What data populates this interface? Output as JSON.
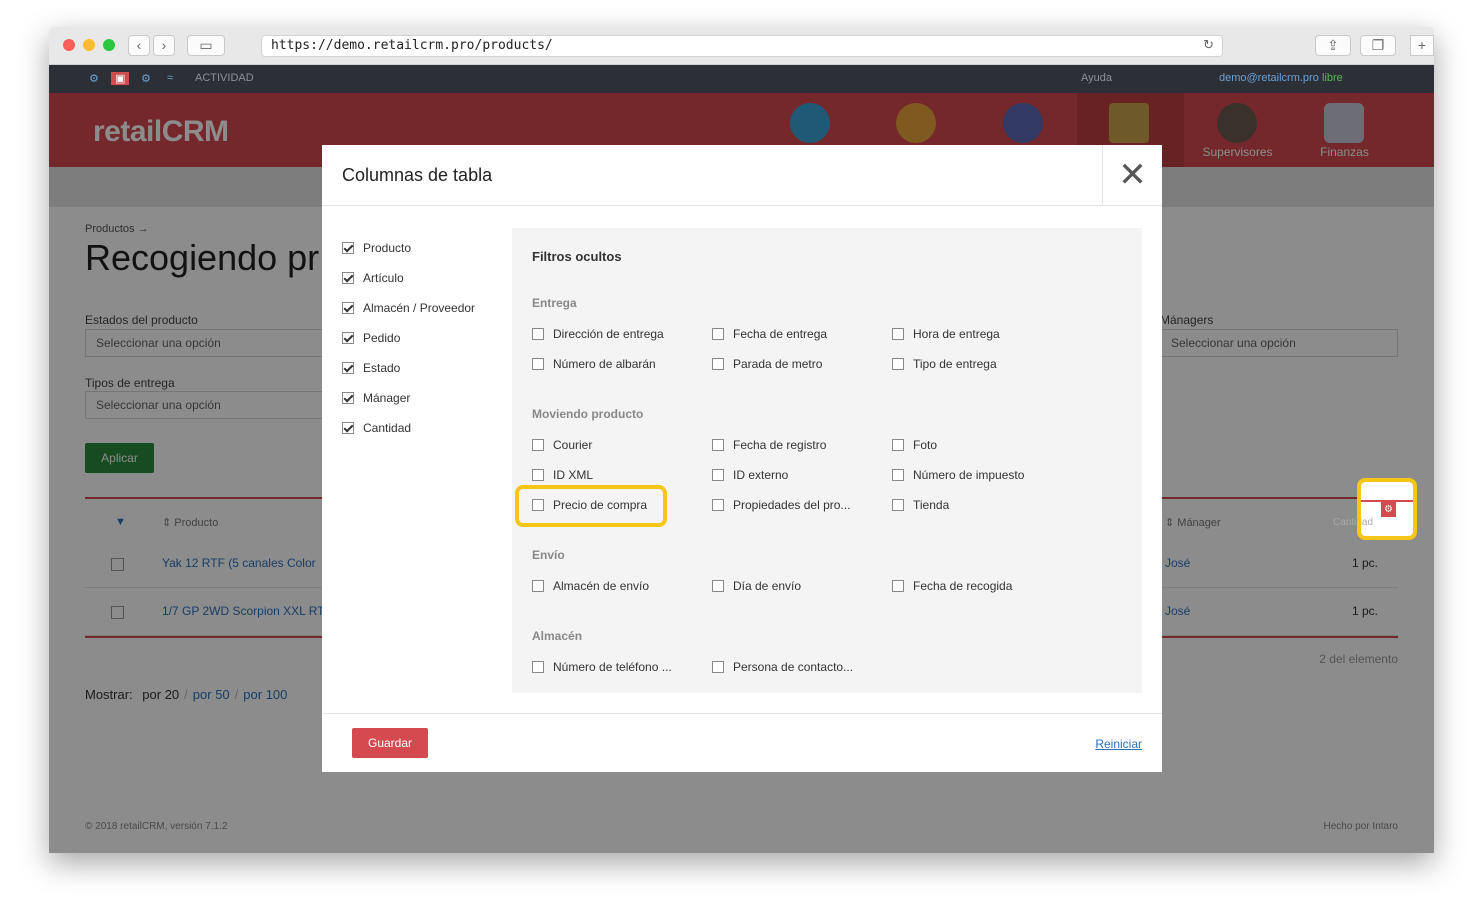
{
  "browser": {
    "url": "https://demo.retailcrm.pro/products/",
    "reload_glyph": "↻",
    "back_glyph": "‹",
    "forward_glyph": "›",
    "sidebar_glyph": "▭",
    "share_glyph": "⇪",
    "tabs_glyph": "❐",
    "newtab_glyph": "+"
  },
  "topbar": {
    "activity": "ACTIVIDAD",
    "help": "Ayuda",
    "user": "demo@retailcrm.pro",
    "status": "libre"
  },
  "header": {
    "logo": "retailCRM",
    "nav": [
      {
        "label": "",
        "icon": "cart-icon"
      },
      {
        "label": "",
        "icon": "customer-icon"
      },
      {
        "label": "",
        "icon": "chat-icon"
      },
      {
        "label": "",
        "icon": "box-icon"
      },
      {
        "label": "Supervisores",
        "icon": "supervisor-icon"
      },
      {
        "label": "Finanzas",
        "icon": "finance-icon"
      }
    ]
  },
  "page": {
    "breadcrumb": "Productos →",
    "title": "Recogiendo pr",
    "filters": {
      "product_states_label": "Estados del producto",
      "product_states_placeholder": "Seleccionar una opción",
      "delivery_types_label": "Tipos de entrega",
      "delivery_types_placeholder": "Seleccionar una opción",
      "managers_label": "Mánagers",
      "managers_placeholder": "Seleccionar una opción"
    },
    "apply_label": "Aplicar",
    "table": {
      "headers": {
        "product": "Producto",
        "manager": "Mánager",
        "quantity": "Cantidad"
      },
      "rows": [
        {
          "product": "Yak 12 RTF (5 canales Color",
          "manager": "José",
          "quantity": "1 pc."
        },
        {
          "product": "1/7 GP 2WD Scorpion XXL RT",
          "manager": "José",
          "quantity": "1 pc."
        }
      ],
      "count": "2 del elemento"
    },
    "show": {
      "label": "Mostrar:",
      "options": [
        "por 20",
        "por 50",
        "por 100"
      ]
    },
    "footer_left": "© 2018 retailCRM, versión 7.1.2",
    "footer_right": "Hecho por Intaro"
  },
  "modal": {
    "title": "Columnas de tabla",
    "close_glyph": "✕",
    "visible_columns": [
      "Producto",
      "Artículo",
      "Almacén / Proveedor",
      "Pedido",
      "Estado",
      "Mánager",
      "Cantidad"
    ],
    "hidden_title": "Filtros ocultos",
    "sections": [
      {
        "title": "Entrega",
        "items": [
          "Dirección de entrega",
          "Fecha de entrega",
          "Hora de entrega",
          "Número de albarán",
          "Parada de metro",
          "Tipo de entrega"
        ]
      },
      {
        "title": "Moviendo producto",
        "items": [
          "Courier",
          "Fecha de registro",
          "Foto",
          "ID XML",
          "ID externo",
          "Número de impuesto",
          "Precio de compra",
          "Propiedades del pro...",
          "Tienda"
        ]
      },
      {
        "title": "Envío",
        "items": [
          "Almacén de envío",
          "Día de envío",
          "Fecha de recogida"
        ]
      },
      {
        "title": "Almacén",
        "items": [
          "Número de teléfono ...",
          "Persona de contacto..."
        ]
      }
    ],
    "save_label": "Guardar",
    "reset_label": "Reiniciar"
  },
  "colors": {
    "brand_red": "#d44a4f",
    "link_blue": "#2c6fb7",
    "apply_green": "#2a8a3d",
    "highlight_yellow": "#f5c518"
  }
}
